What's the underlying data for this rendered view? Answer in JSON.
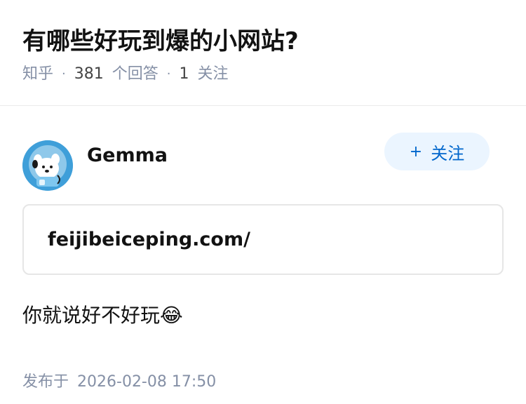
{
  "question": {
    "title": "有哪些好玩到爆的小网站?",
    "source": "知乎",
    "answer_count": "381",
    "answer_label": "个回答",
    "follower_count": "1",
    "follower_label": "关注"
  },
  "answer": {
    "author_name": "Gemma",
    "follow_label": "关注",
    "link_text": "feijibeiceping.com/",
    "content_text": "你就说好不好玩😂",
    "publish_label": "发布于",
    "publish_time": "2026-02-08 17:50"
  },
  "colors": {
    "meta_gray": "#8590a6",
    "follow_bg": "#ebf5ff",
    "follow_text": "#0066cc"
  },
  "icons": {
    "plus": "plus-icon",
    "avatar": "avatar-image"
  }
}
